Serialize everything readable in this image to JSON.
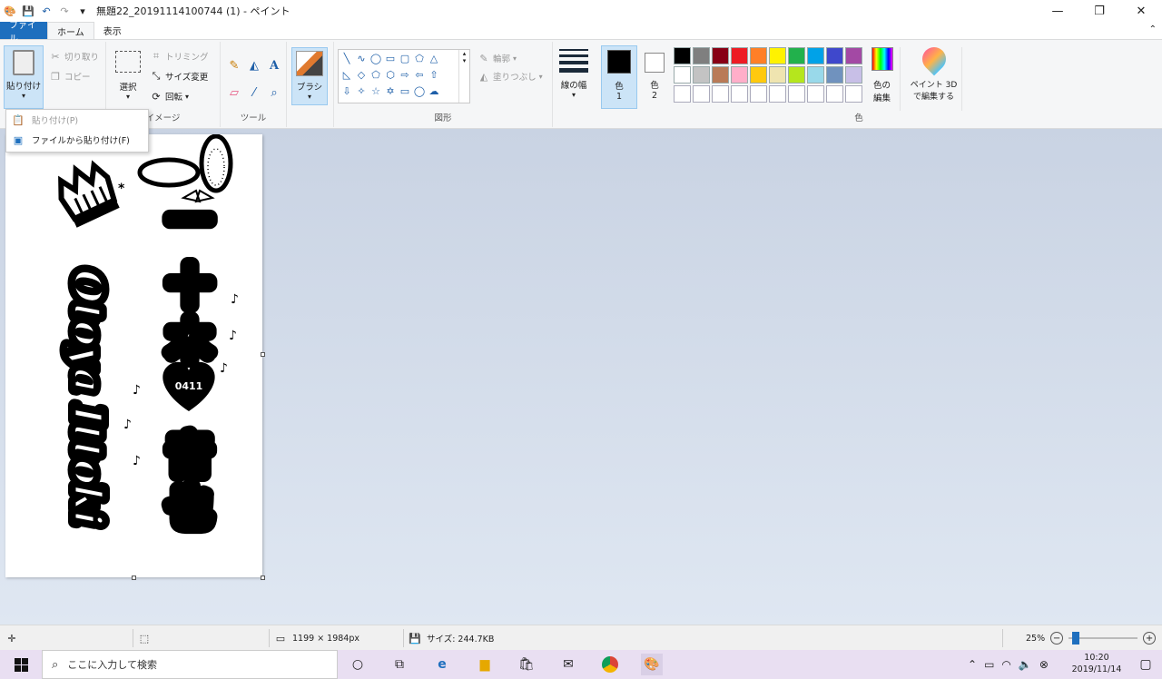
{
  "window": {
    "title": "無題22_20191114100744 (1) - ペイント",
    "minimize": "—",
    "restore": "❐",
    "close": "✕"
  },
  "tabs": {
    "file": "ファイル",
    "home": "ホーム",
    "view": "表示"
  },
  "ribbon": {
    "clipboard": {
      "paste": "貼り付け",
      "cut": "切り取り",
      "copy": "コピー"
    },
    "image": {
      "select": "選択",
      "crop": "トリミング",
      "resize": "サイズ変更",
      "rotate": "回転",
      "label": "イメージ"
    },
    "tools": {
      "label": "ツール"
    },
    "brush": {
      "label": "ブラシ"
    },
    "shapes": {
      "outline": "輪郭",
      "fill": "塗りつぶし",
      "label": "図形"
    },
    "size": {
      "label": "線の幅"
    },
    "color1": {
      "label": "色",
      "num": "1"
    },
    "color2": {
      "label": "色",
      "num": "2"
    },
    "palette": {
      "row1": [
        "#000000",
        "#7f7f7f",
        "#880015",
        "#ed1c24",
        "#ff7f27",
        "#fff200",
        "#22b14c",
        "#00a2e8",
        "#3f48cc",
        "#a349a4"
      ],
      "row2": [
        "#ffffff",
        "#c3c3c3",
        "#b97a57",
        "#ffaec9",
        "#ffc90e",
        "#efe4b0",
        "#b5e61d",
        "#99d9ea",
        "#7092be",
        "#c8bfe7"
      ],
      "label": "色"
    },
    "edit_colors": {
      "line1": "色の",
      "line2": "編集"
    },
    "paint3d": {
      "line1": "ペイント 3D",
      "line2": "で編集する"
    }
  },
  "dropdown": {
    "paste": "貼り付け(P)",
    "paste_from": "ファイルから貼り付け(F)"
  },
  "canvas": {
    "vertical_name_jp": [
      "一",
      "十",
      "木",
      "音",
      "也"
    ],
    "heart_text": "0411",
    "romaji": "Otoya Ittoki"
  },
  "status": {
    "dimensions": "1199 × 1984px",
    "size": "サイズ: 244.7KB",
    "zoom": "25%"
  },
  "taskbar": {
    "search_placeholder": "ここに入力して検索",
    "time": "10:20",
    "date": "2019/11/14"
  }
}
